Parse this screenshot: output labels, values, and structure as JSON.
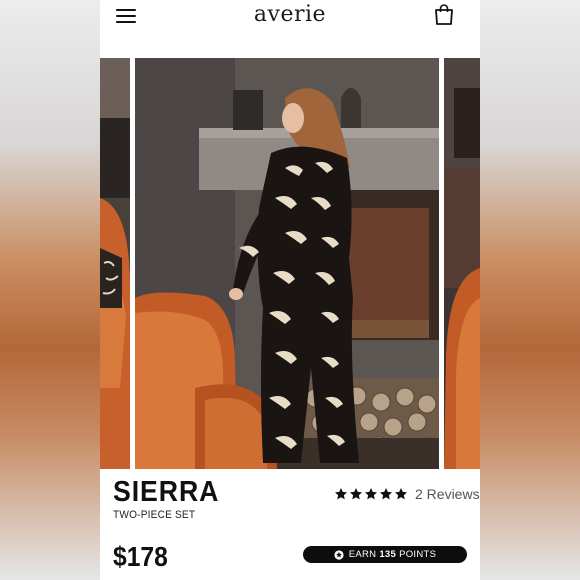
{
  "header": {
    "logo": "averie",
    "menu_icon": "hamburger-menu-icon",
    "bag_icon": "shopping-bag-icon"
  },
  "product": {
    "name": "SIERRA",
    "subtitle": "TWO-PIECE SET",
    "rating": 5,
    "reviews_label": "2 Reviews",
    "price": "$178"
  },
  "rewards": {
    "earn_prefix": "EARN",
    "points": "135",
    "points_suffix": "POINTS"
  },
  "colors": {
    "text": "#111111",
    "badge_bg": "#0d0d0d",
    "pajama": "#1a1512",
    "chair": "#c7602a"
  }
}
